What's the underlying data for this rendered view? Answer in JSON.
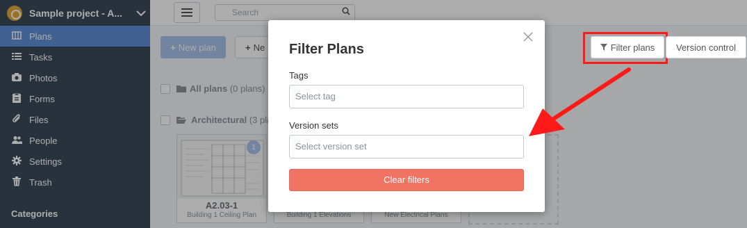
{
  "sidebar": {
    "project_name": "Sample project - A...",
    "items": [
      {
        "label": "Plans",
        "icon": "plans-icon"
      },
      {
        "label": "Tasks",
        "icon": "list-icon"
      },
      {
        "label": "Photos",
        "icon": "camera-icon"
      },
      {
        "label": "Forms",
        "icon": "clipboard-icon"
      },
      {
        "label": "Files",
        "icon": "paperclip-icon"
      },
      {
        "label": "People",
        "icon": "people-icon"
      },
      {
        "label": "Settings",
        "icon": "gear-icon"
      },
      {
        "label": "Trash",
        "icon": "trash-icon"
      }
    ],
    "categories_label": "Categories"
  },
  "topbar": {
    "search_placeholder": "Search"
  },
  "toolbar": {
    "new_plan_label": "New plan",
    "second_button_label": "Ne",
    "filter_plans_label": "Filter plans",
    "version_control_label": "Version control"
  },
  "plans": {
    "all_plans": {
      "name": "All plans",
      "count": "(0 plans)"
    },
    "architectural": {
      "name": "Architectural",
      "count": "(3 pla"
    },
    "cards": [
      {
        "code": "A2.03-1",
        "name": "Building 1 Ceiling Plan",
        "badge": "1"
      },
      {
        "code": "",
        "name": "Building 1 Elevations"
      },
      {
        "code": "",
        "name": "New Electrical Plans"
      }
    ]
  },
  "modal": {
    "title": "Filter Plans",
    "tags_label": "Tags",
    "tags_placeholder": "Select tag",
    "version_sets_label": "Version sets",
    "version_sets_placeholder": "Select version set",
    "clear_button_label": "Clear filters"
  },
  "colors": {
    "sidebar_bg": "#3c4a5a",
    "active_item": "#5f8fd6",
    "primary_button": "#a8c3ec",
    "clear_button": "#ef7463",
    "annotation": "#ff1a1a"
  }
}
